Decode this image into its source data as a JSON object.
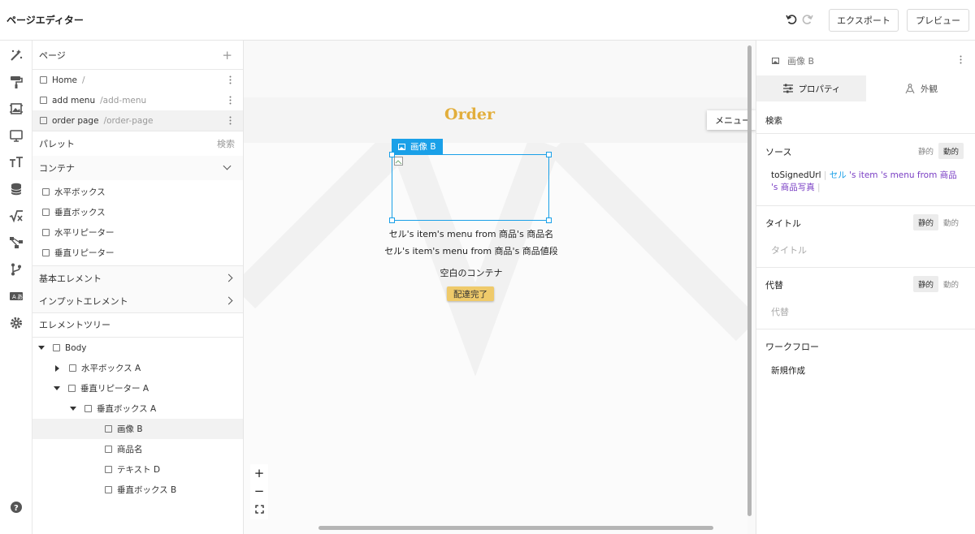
{
  "header": {
    "title": "ページエディター",
    "export_label": "エクスポート",
    "preview_label": "プレビュー"
  },
  "left": {
    "pages_heading": "ページ",
    "pages": [
      {
        "name": "Home",
        "path": "/"
      },
      {
        "name": "add menu",
        "path": "/add-menu"
      },
      {
        "name": "order page",
        "path": "/order-page"
      }
    ],
    "palette_heading": "パレット",
    "palette_search": "検索",
    "container_heading": "コンテナ",
    "containers": [
      "水平ボックス",
      "垂直ボックス",
      "水平リピーター",
      "垂直リピーター"
    ],
    "basic_elements": "基本エレメント",
    "input_elements": "インプットエレメント",
    "tree_heading": "エレメントツリー",
    "tree": [
      "Body",
      "水平ボックス A",
      "垂直リピーター A",
      "垂直ボックス A",
      "画像 B",
      "商品名",
      "テキスト D",
      "垂直ボックス B"
    ]
  },
  "canvas": {
    "title": "Order",
    "selected_label": "画像 B",
    "line1": "セル's item's menu from 商品's 商品名",
    "line2": "セル's item's menu from 商品's 商品値段",
    "empty_container": "空白のコンテナ",
    "button": "配達完了",
    "menu_tip": "メニュー",
    "zoom_in": "+",
    "zoom_out": "−"
  },
  "right": {
    "element_name": "画像 B",
    "tab_properties": "プロパティ",
    "tab_appearance": "外観",
    "search": "検索",
    "source_label": "ソース",
    "static": "静的",
    "dynamic": "動的",
    "source_fn": "toSignedUrl",
    "source_cell": "セル",
    "source_s1": "'s",
    "source_item": "item",
    "source_s2": "'s",
    "source_menu": "menu from 商品",
    "source_s3": "'s",
    "source_photo": "商品写真",
    "title_label": "タイトル",
    "title_placeholder": "タイトル",
    "alt_label": "代替",
    "alt_placeholder": "代替",
    "workflow_label": "ワークフロー",
    "new_create": "新規作成"
  },
  "colors": {
    "accent": "#1aa0e8",
    "order_title": "#e2ae3c",
    "button_bg": "#efca6a",
    "source_link": "#1aa0e8",
    "source_purple": "#7a3fc4"
  }
}
